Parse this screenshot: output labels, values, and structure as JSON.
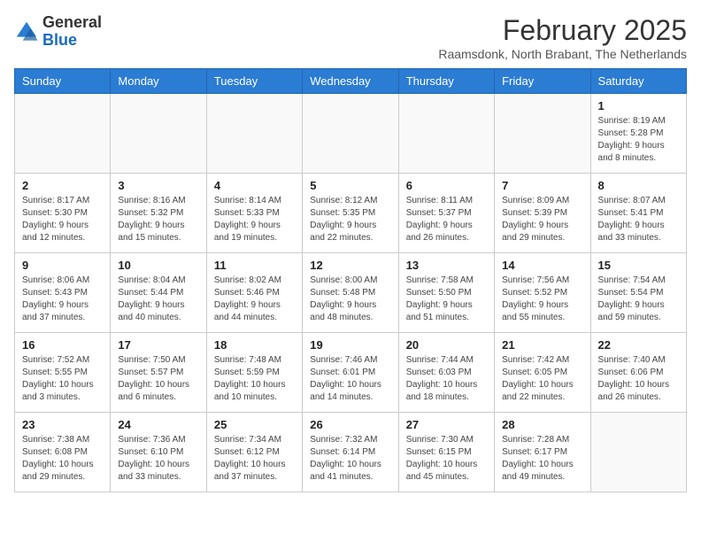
{
  "logo": {
    "general": "General",
    "blue": "Blue"
  },
  "title": "February 2025",
  "subtitle": "Raamsdonk, North Brabant, The Netherlands",
  "days_of_week": [
    "Sunday",
    "Monday",
    "Tuesday",
    "Wednesday",
    "Thursday",
    "Friday",
    "Saturday"
  ],
  "weeks": [
    [
      {
        "day": "",
        "info": ""
      },
      {
        "day": "",
        "info": ""
      },
      {
        "day": "",
        "info": ""
      },
      {
        "day": "",
        "info": ""
      },
      {
        "day": "",
        "info": ""
      },
      {
        "day": "",
        "info": ""
      },
      {
        "day": "1",
        "info": "Sunrise: 8:19 AM\nSunset: 5:28 PM\nDaylight: 9 hours and 8 minutes."
      }
    ],
    [
      {
        "day": "2",
        "info": "Sunrise: 8:17 AM\nSunset: 5:30 PM\nDaylight: 9 hours and 12 minutes."
      },
      {
        "day": "3",
        "info": "Sunrise: 8:16 AM\nSunset: 5:32 PM\nDaylight: 9 hours and 15 minutes."
      },
      {
        "day": "4",
        "info": "Sunrise: 8:14 AM\nSunset: 5:33 PM\nDaylight: 9 hours and 19 minutes."
      },
      {
        "day": "5",
        "info": "Sunrise: 8:12 AM\nSunset: 5:35 PM\nDaylight: 9 hours and 22 minutes."
      },
      {
        "day": "6",
        "info": "Sunrise: 8:11 AM\nSunset: 5:37 PM\nDaylight: 9 hours and 26 minutes."
      },
      {
        "day": "7",
        "info": "Sunrise: 8:09 AM\nSunset: 5:39 PM\nDaylight: 9 hours and 29 minutes."
      },
      {
        "day": "8",
        "info": "Sunrise: 8:07 AM\nSunset: 5:41 PM\nDaylight: 9 hours and 33 minutes."
      }
    ],
    [
      {
        "day": "9",
        "info": "Sunrise: 8:06 AM\nSunset: 5:43 PM\nDaylight: 9 hours and 37 minutes."
      },
      {
        "day": "10",
        "info": "Sunrise: 8:04 AM\nSunset: 5:44 PM\nDaylight: 9 hours and 40 minutes."
      },
      {
        "day": "11",
        "info": "Sunrise: 8:02 AM\nSunset: 5:46 PM\nDaylight: 9 hours and 44 minutes."
      },
      {
        "day": "12",
        "info": "Sunrise: 8:00 AM\nSunset: 5:48 PM\nDaylight: 9 hours and 48 minutes."
      },
      {
        "day": "13",
        "info": "Sunrise: 7:58 AM\nSunset: 5:50 PM\nDaylight: 9 hours and 51 minutes."
      },
      {
        "day": "14",
        "info": "Sunrise: 7:56 AM\nSunset: 5:52 PM\nDaylight: 9 hours and 55 minutes."
      },
      {
        "day": "15",
        "info": "Sunrise: 7:54 AM\nSunset: 5:54 PM\nDaylight: 9 hours and 59 minutes."
      }
    ],
    [
      {
        "day": "16",
        "info": "Sunrise: 7:52 AM\nSunset: 5:55 PM\nDaylight: 10 hours and 3 minutes."
      },
      {
        "day": "17",
        "info": "Sunrise: 7:50 AM\nSunset: 5:57 PM\nDaylight: 10 hours and 6 minutes."
      },
      {
        "day": "18",
        "info": "Sunrise: 7:48 AM\nSunset: 5:59 PM\nDaylight: 10 hours and 10 minutes."
      },
      {
        "day": "19",
        "info": "Sunrise: 7:46 AM\nSunset: 6:01 PM\nDaylight: 10 hours and 14 minutes."
      },
      {
        "day": "20",
        "info": "Sunrise: 7:44 AM\nSunset: 6:03 PM\nDaylight: 10 hours and 18 minutes."
      },
      {
        "day": "21",
        "info": "Sunrise: 7:42 AM\nSunset: 6:05 PM\nDaylight: 10 hours and 22 minutes."
      },
      {
        "day": "22",
        "info": "Sunrise: 7:40 AM\nSunset: 6:06 PM\nDaylight: 10 hours and 26 minutes."
      }
    ],
    [
      {
        "day": "23",
        "info": "Sunrise: 7:38 AM\nSunset: 6:08 PM\nDaylight: 10 hours and 29 minutes."
      },
      {
        "day": "24",
        "info": "Sunrise: 7:36 AM\nSunset: 6:10 PM\nDaylight: 10 hours and 33 minutes."
      },
      {
        "day": "25",
        "info": "Sunrise: 7:34 AM\nSunset: 6:12 PM\nDaylight: 10 hours and 37 minutes."
      },
      {
        "day": "26",
        "info": "Sunrise: 7:32 AM\nSunset: 6:14 PM\nDaylight: 10 hours and 41 minutes."
      },
      {
        "day": "27",
        "info": "Sunrise: 7:30 AM\nSunset: 6:15 PM\nDaylight: 10 hours and 45 minutes."
      },
      {
        "day": "28",
        "info": "Sunrise: 7:28 AM\nSunset: 6:17 PM\nDaylight: 10 hours and 49 minutes."
      },
      {
        "day": "",
        "info": ""
      }
    ]
  ]
}
